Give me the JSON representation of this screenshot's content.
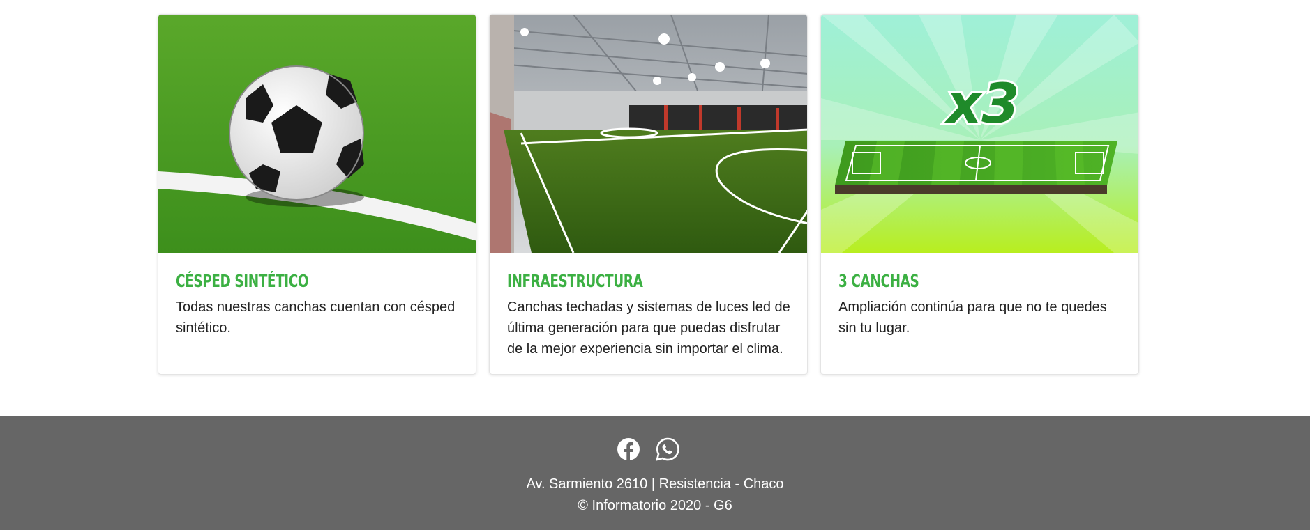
{
  "cards": [
    {
      "title": "CÉSPED SINTÉTICO",
      "text": "Todas nuestras canchas cuentan con césped sintético.",
      "image": "soccer-ball-on-turf"
    },
    {
      "title": "INFRAESTRUCTURA",
      "text": "Canchas techadas y sistemas de luces led de última generación para que puedas disfrutar de la mejor experiencia sin importar el clima.",
      "image": "indoor-field"
    },
    {
      "title": "3 CANCHAS",
      "text": "Ampliación continúa para que no te quedes sin tu lugar.",
      "image": "three-fields-graphic",
      "badge": "x3"
    }
  ],
  "footer": {
    "icons": [
      "facebook-icon",
      "whatsapp-icon"
    ],
    "address": "Av. Sarmiento 2610 | Resistencia - Chaco",
    "copyright": "© Informatorio 2020 - G6"
  },
  "colors": {
    "title_green": "#3cb043",
    "footer_bg": "#666666"
  }
}
